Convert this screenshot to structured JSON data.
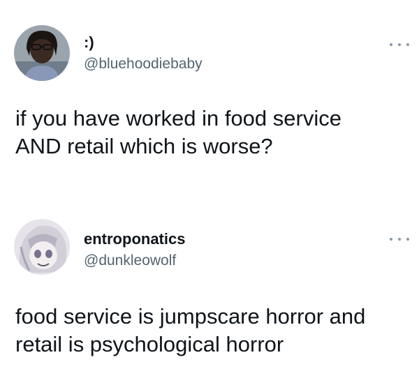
{
  "tweets": [
    {
      "display_name": ":)",
      "handle": "@bluehoodiebaby",
      "text": "if you have worked in food service\nAND retail which is worse?",
      "avatar_icon": "user-avatar-photo",
      "more_icon": "more-options-icon"
    },
    {
      "display_name": "entroponatics",
      "handle": "@dunkleowolf",
      "text": "food service is jumpscare horror and\nretail is psychological horror",
      "avatar_icon": "anime-character-avatar",
      "more_icon": "more-options-icon"
    }
  ]
}
